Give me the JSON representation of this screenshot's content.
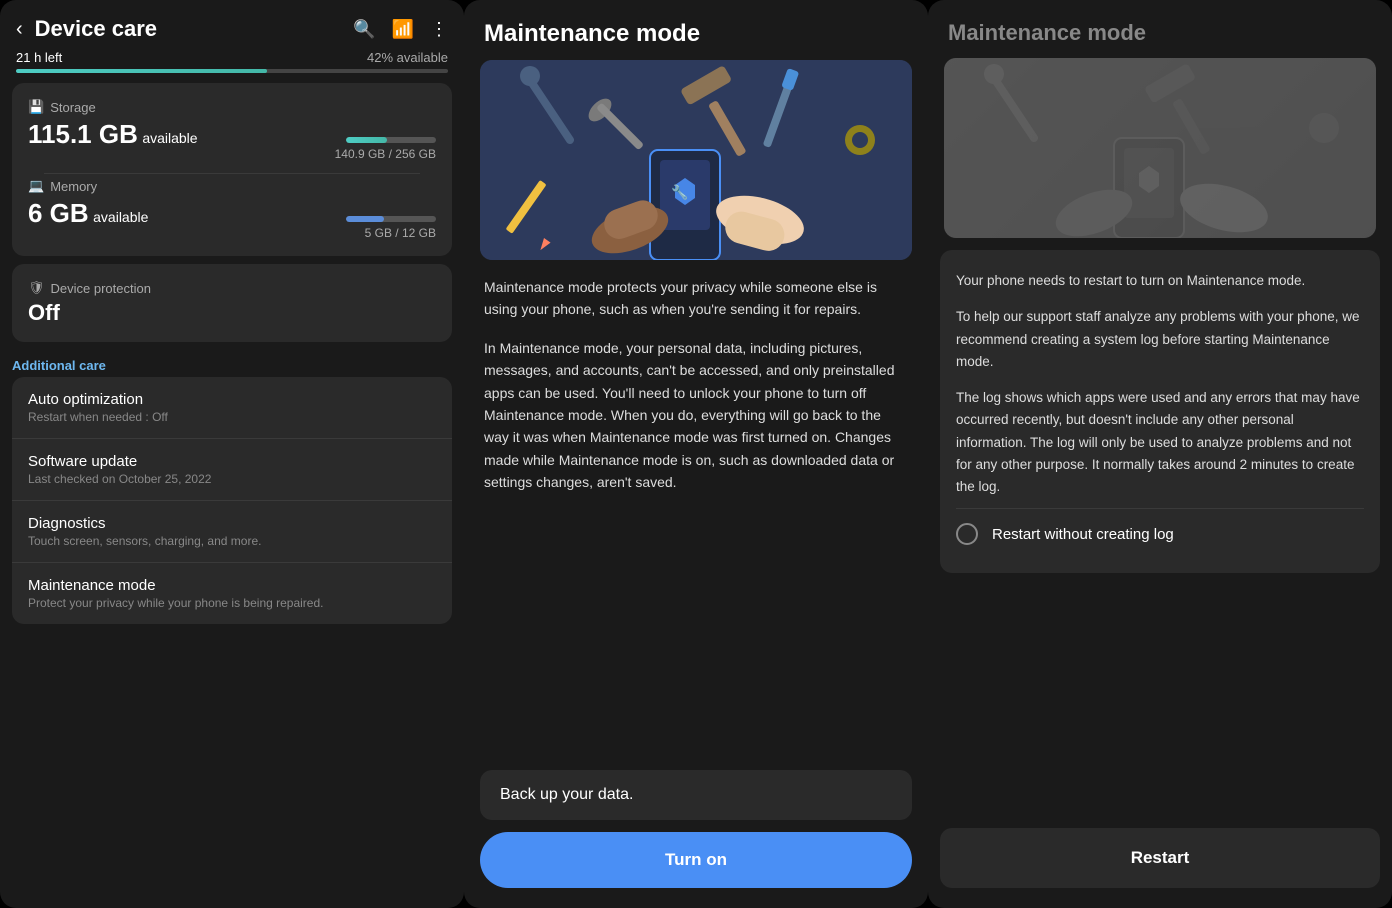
{
  "panel1": {
    "title": "Device care",
    "storage_left": "21 h left",
    "storage_available_pct": "42% available",
    "storage_section_label": "Storage",
    "storage_value": "115.1 GB",
    "storage_unit_label": "available",
    "storage_detail": "140.9 GB / 256 GB",
    "storage_fill_pct": 45,
    "memory_section_label": "Memory",
    "memory_value": "6 GB",
    "memory_unit_label": "available",
    "memory_detail": "5 GB / 12 GB",
    "memory_fill_pct": 42,
    "protection_label": "Device protection",
    "protection_value": "Off",
    "additional_care_title": "Additional care",
    "menu_items": [
      {
        "title": "Auto optimization",
        "subtitle": "Restart when needed : Off"
      },
      {
        "title": "Software update",
        "subtitle": "Last checked on October 25, 2022"
      },
      {
        "title": "Diagnostics",
        "subtitle": "Touch screen, sensors, charging, and more."
      },
      {
        "title": "Maintenance mode",
        "subtitle": "Protect your privacy while your phone is being repaired."
      }
    ]
  },
  "panel2": {
    "title": "Maintenance mode",
    "description1": "Maintenance mode protects your privacy while someone else is using your phone, such as when you're sending it for repairs.",
    "description2": "In Maintenance mode, your personal data, including pictures, messages, and accounts, can't be accessed, and only preinstalled apps can be used. You'll need to unlock your phone to turn off Maintenance mode. When you do, everything will go back to the way it was when Maintenance mode was first turned on. Changes made while Maintenance mode is on, such as downloaded data or settings changes, aren't saved.",
    "backup_text": "Back up your data.",
    "turn_on_label": "Turn on"
  },
  "panel3": {
    "title": "Maintenance mode",
    "info_text1": "Your phone needs to restart to turn on Maintenance mode.",
    "info_text2": "To help our support staff analyze any problems with your phone, we recommend creating a system log before starting Maintenance mode.",
    "info_text3": "The log shows which apps were used and any errors that may have occurred recently, but doesn't include any other personal information. The log will only be used to analyze problems and not for any other purpose. It normally takes around 2 minutes to create the log.",
    "radio_label": "Restart without creating log",
    "restart_label": "Restart"
  }
}
